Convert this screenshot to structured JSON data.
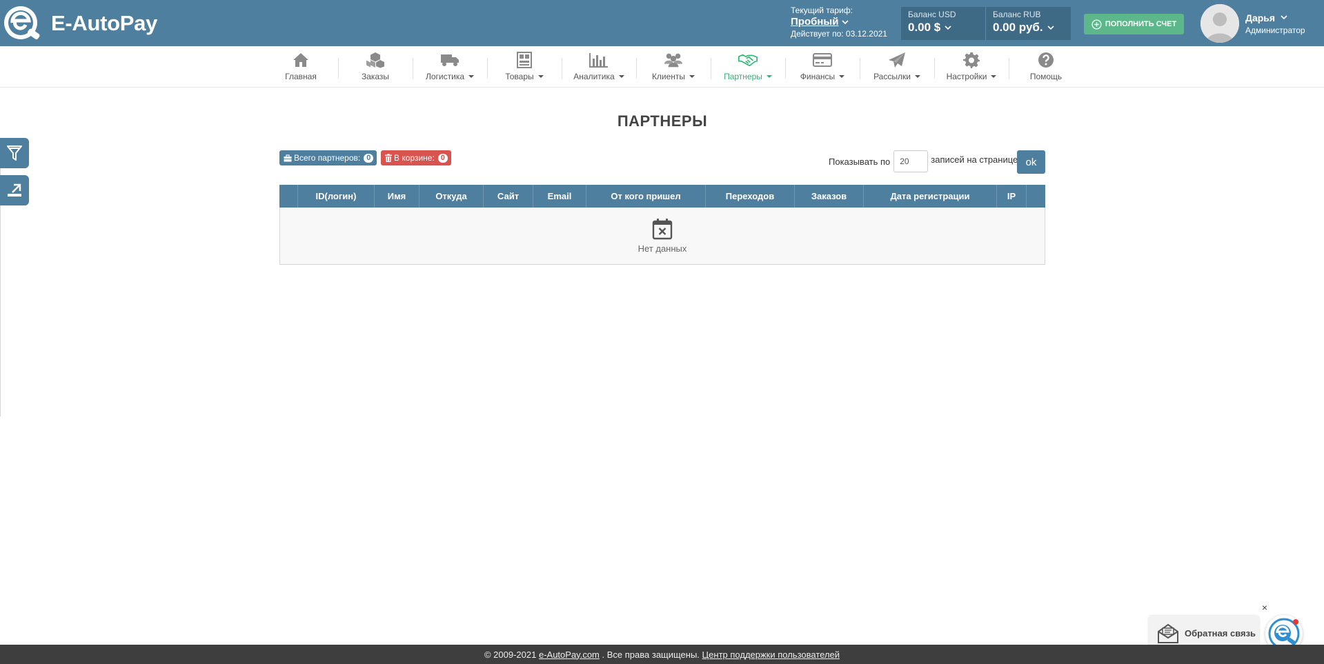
{
  "header": {
    "brand": "E-AutoPay",
    "tariff_label": "Текущий тариф:",
    "tariff_plan": "Пробный",
    "tariff_valid": "Действует по: 03.12.2021",
    "balance_usd_label": "Баланс USD",
    "balance_usd_value": "0.00 $",
    "balance_rub_label": "Баланс RUB",
    "balance_rub_value": "0.00 руб.",
    "topup_label": "ПОПОЛНИТЬ СЧЕТ",
    "user_name": "Дарья",
    "user_role": "Администратор",
    "colors": {
      "bar": "#4f7f9f",
      "topup": "#5cb88a"
    }
  },
  "nav": {
    "items": [
      {
        "label": "Главная",
        "icon": "home-icon"
      },
      {
        "label": "Заказы",
        "icon": "boxes-icon"
      },
      {
        "label": "Логистика",
        "icon": "truck-icon"
      },
      {
        "label": "Товары",
        "icon": "grid-icon"
      },
      {
        "label": "Аналитика",
        "icon": "bar-chart-icon"
      },
      {
        "label": "Клиенты",
        "icon": "users-icon"
      },
      {
        "label": "Партнеры",
        "icon": "handshake-icon"
      },
      {
        "label": "Финансы",
        "icon": "credit-card-icon"
      },
      {
        "label": "Рассылки",
        "icon": "paper-plane-icon"
      },
      {
        "label": "Настройки",
        "icon": "gear-icon"
      },
      {
        "label": "Помощь",
        "icon": "question-circle-icon"
      }
    ],
    "active_color": "#2bb673"
  },
  "side": {
    "filter_icon": "filter-icon",
    "export_icon": "export-icon"
  },
  "page": {
    "title": "ПАРТНЕРЫ",
    "total_label": "Всего партнеров:",
    "total_count": "0",
    "trash_label": "В корзине:",
    "trash_count": "0",
    "perpage_prefix": "Показывать по",
    "perpage_value": "20",
    "perpage_suffix": "записей на странице",
    "ok_label": "ok"
  },
  "table": {
    "columns": [
      "",
      "ID(логин)",
      "Имя",
      "Откуда",
      "Сайт",
      "Email",
      "От кого пришел",
      "Переходов",
      "Заказов",
      "Дата регистрации",
      "IP",
      ""
    ],
    "empty_text": "Нет данных"
  },
  "footer": {
    "copyright": "© 2009-2021",
    "site_link": "e-AutoPay.com",
    "rights": ". Все права защищены.",
    "support_link": "Центр поддержки пользователей"
  },
  "feedback": {
    "label": "Обратная связь",
    "close": "×"
  }
}
